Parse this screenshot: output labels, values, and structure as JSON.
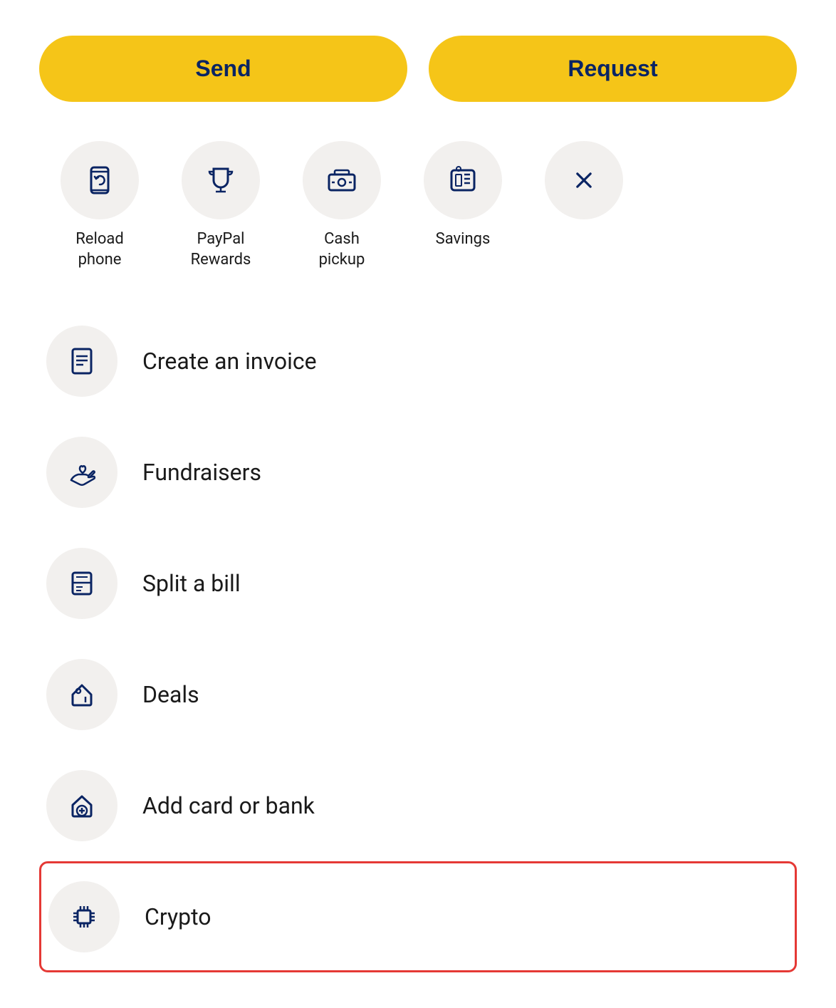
{
  "buttons": {
    "send_label": "Send",
    "request_label": "Request"
  },
  "quick_actions": [
    {
      "id": "reload-phone",
      "label": "Reload\nphone",
      "label_line1": "Reload",
      "label_line2": "phone",
      "icon": "reload-phone-icon"
    },
    {
      "id": "paypal-rewards",
      "label": "PayPal\nRewards",
      "label_line1": "PayPal",
      "label_line2": "Rewards",
      "icon": "trophy-icon"
    },
    {
      "id": "cash-pickup",
      "label": "Cash\npickup",
      "label_line1": "Cash",
      "label_line2": "pickup",
      "icon": "cash-pickup-icon"
    },
    {
      "id": "savings",
      "label": "Savings",
      "label_line1": "Savings",
      "label_line2": "",
      "icon": "savings-icon"
    },
    {
      "id": "close",
      "label": "",
      "label_line1": "",
      "label_line2": "",
      "icon": "close-icon"
    }
  ],
  "menu_items": [
    {
      "id": "create-invoice",
      "label": "Create an invoice",
      "icon": "invoice-icon",
      "highlighted": false
    },
    {
      "id": "fundraisers",
      "label": "Fundraisers",
      "icon": "fundraisers-icon",
      "highlighted": false
    },
    {
      "id": "split-bill",
      "label": "Split a bill",
      "icon": "split-bill-icon",
      "highlighted": false
    },
    {
      "id": "deals",
      "label": "Deals",
      "icon": "deals-icon",
      "highlighted": false
    },
    {
      "id": "add-card-bank",
      "label": "Add card or bank",
      "icon": "add-card-icon",
      "highlighted": false
    },
    {
      "id": "crypto",
      "label": "Crypto",
      "icon": "crypto-icon",
      "highlighted": true
    }
  ],
  "colors": {
    "navy": "#0a2463",
    "yellow": "#F5C518",
    "icon_bg": "#f2f0ee",
    "highlight_border": "#e53935"
  }
}
